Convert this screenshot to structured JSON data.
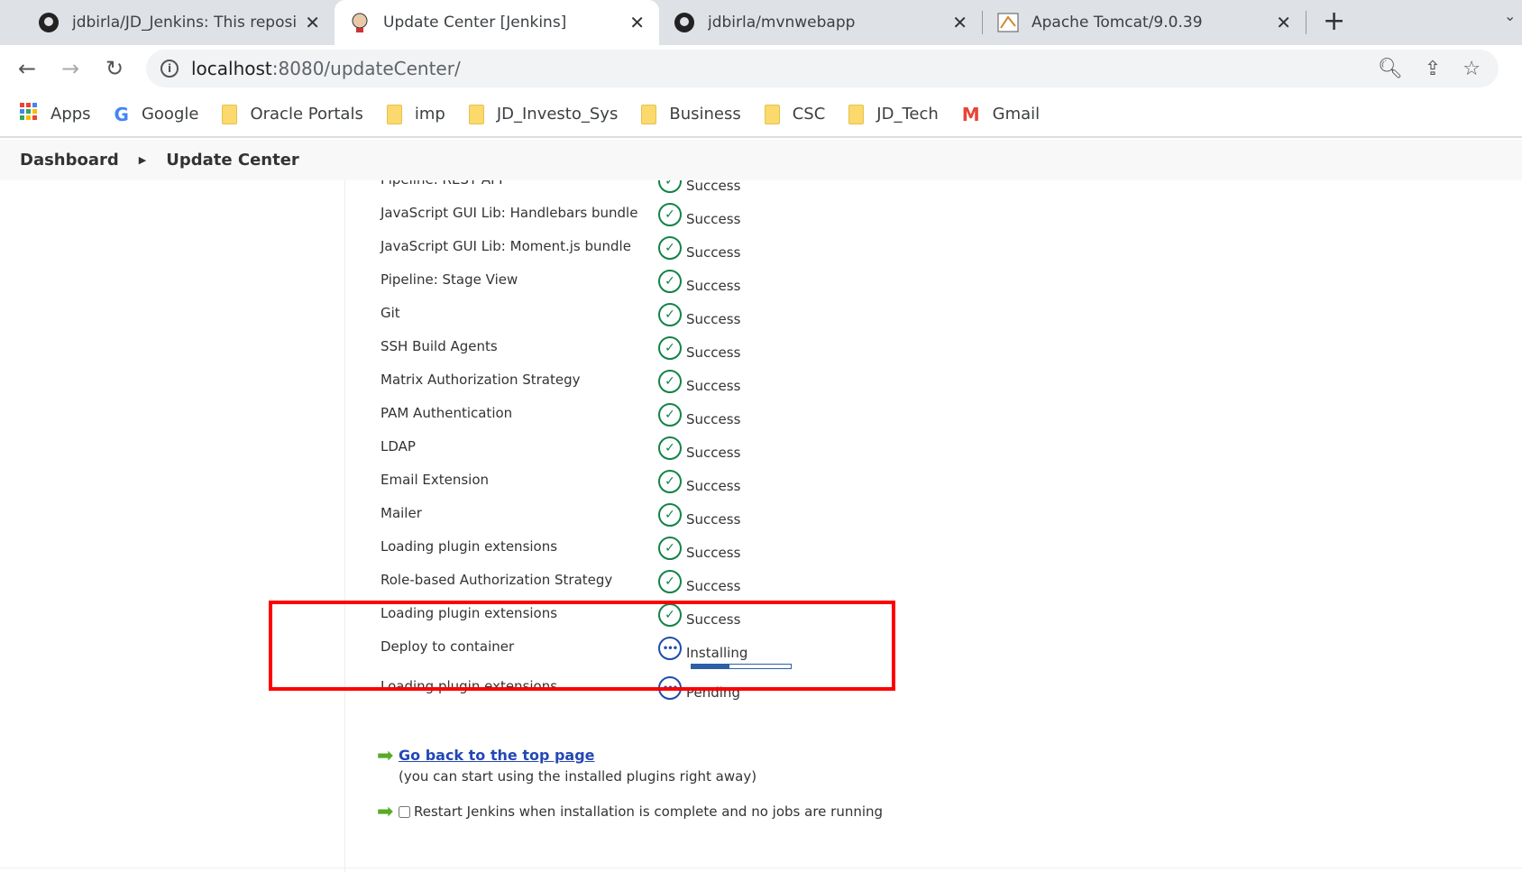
{
  "tabs": [
    {
      "title": "jdbirla/JD_Jenkins: This repository",
      "icon": "github-icon",
      "active": false
    },
    {
      "title": "Update Center [Jenkins]",
      "icon": "jenkins-icon",
      "active": true
    },
    {
      "title": "jdbirla/mvnwebapp",
      "icon": "github-icon",
      "active": false
    },
    {
      "title": "Apache Tomcat/9.0.39",
      "icon": "tomcat-icon",
      "active": false
    }
  ],
  "address": {
    "host": "localhost",
    "path": ":8080/updateCenter/"
  },
  "bookmarks": [
    "Apps",
    "Google",
    "Oracle Portals",
    "imp",
    "JD_Investo_Sys",
    "Business",
    "CSC",
    "JD_Tech",
    "Gmail"
  ],
  "breadcrumb": [
    "Dashboard",
    "Update Center"
  ],
  "plugins": [
    {
      "name": "Pipeline: REST API",
      "status": "Success"
    },
    {
      "name": "JavaScript GUI Lib: Handlebars bundle",
      "status": "Success"
    },
    {
      "name": "JavaScript GUI Lib: Moment.js bundle",
      "status": "Success"
    },
    {
      "name": "Pipeline: Stage View",
      "status": "Success"
    },
    {
      "name": "Git",
      "status": "Success"
    },
    {
      "name": "SSH Build Agents",
      "status": "Success"
    },
    {
      "name": "Matrix Authorization Strategy",
      "status": "Success"
    },
    {
      "name": "PAM Authentication",
      "status": "Success"
    },
    {
      "name": "LDAP",
      "status": "Success"
    },
    {
      "name": "Email Extension",
      "status": "Success"
    },
    {
      "name": "Mailer",
      "status": "Success"
    },
    {
      "name": "Loading plugin extensions",
      "status": "Success"
    },
    {
      "name": "Role-based Authorization Strategy",
      "status": "Success"
    },
    {
      "name": "Loading plugin extensions",
      "status": "Success"
    },
    {
      "name": "Deploy to container",
      "status": "Installing",
      "progress_percent": 38
    },
    {
      "name": "Loading plugin extensions",
      "status": "Pending"
    }
  ],
  "links": {
    "back": "Go back to the top page",
    "note": "(you can start using the installed plugins right away)",
    "restart": "Restart Jenkins when installation is complete and no jobs are running"
  },
  "colors": {
    "success": "#138347",
    "pending": "#1a4fa8",
    "highlight": "#ff0000",
    "link": "#2447b4"
  }
}
